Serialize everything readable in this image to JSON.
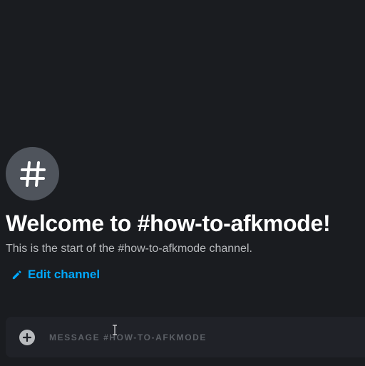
{
  "channel": {
    "icon": "hash-icon",
    "welcome_title": "Welcome to #how-to-afkmode!",
    "welcome_subtitle": "This is the start of the #how-to-afkmode channel.",
    "edit_label": "Edit channel",
    "edit_icon": "pencil-icon"
  },
  "composer": {
    "add_icon": "plus-circle-icon",
    "placeholder": "MESSAGE #HOW-TO-AFKMODE",
    "value": ""
  },
  "colors": {
    "background": "#1a1c20",
    "composer_background": "#202228",
    "accent_link": "#00a8fc",
    "title": "#ffffff",
    "subtitle": "#b9bbbe",
    "icon_circle": "#4f545c"
  }
}
